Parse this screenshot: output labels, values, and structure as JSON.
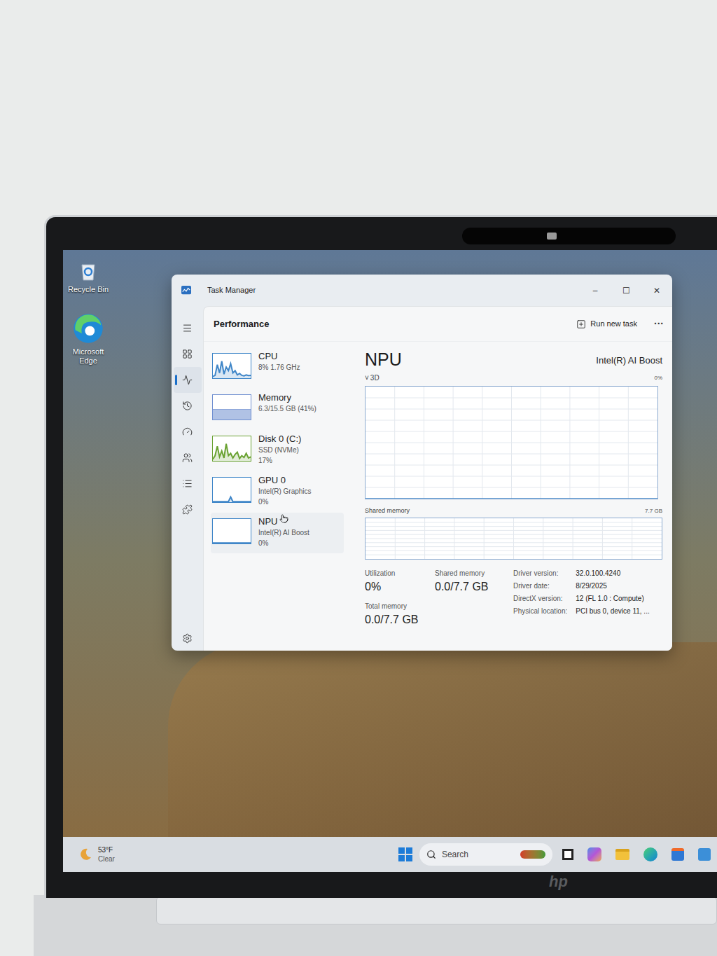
{
  "desktop_icons": [
    {
      "label": "Recycle Bin"
    },
    {
      "label": "Microsoft Edge"
    }
  ],
  "window": {
    "title": "Task Manager",
    "controls": [
      "–",
      "☐",
      "✕"
    ]
  },
  "nav": [
    {
      "selected": false
    },
    {
      "selected": false
    },
    {
      "selected": true
    },
    {
      "selected": false
    },
    {
      "selected": false
    },
    {
      "selected": false
    },
    {
      "selected": false
    },
    {
      "selected": false
    }
  ],
  "header": {
    "title": "Performance",
    "action": "Run new task",
    "more": "···"
  },
  "devices": [
    {
      "name": "CPU",
      "lines": [
        "8% 1.76 GHz"
      ],
      "kind": "line",
      "color": "#3f86c8",
      "selected": false,
      "values": [
        5,
        10,
        55,
        20,
        70,
        15,
        45,
        30,
        60,
        20,
        30,
        12,
        18,
        10,
        8,
        12,
        9,
        10
      ]
    },
    {
      "name": "Memory",
      "lines": [
        "6.3/15.5 GB (41%)"
      ],
      "kind": "fill",
      "color": "#6f8fd0",
      "selected": false,
      "level": 0.41
    },
    {
      "name": "Disk 0 (C:)",
      "lines": [
        "SSD (NVMe)",
        "17%"
      ],
      "kind": "line",
      "color": "#6aa232",
      "selected": false,
      "values": [
        5,
        20,
        60,
        15,
        40,
        10,
        70,
        20,
        30,
        10,
        25,
        35,
        8,
        20,
        12,
        30,
        10,
        15
      ]
    },
    {
      "name": "GPU 0",
      "lines": [
        "Intel(R) Graphics",
        "0%"
      ],
      "kind": "line",
      "color": "#3f86c8",
      "selected": false,
      "values": [
        0,
        0,
        0,
        0,
        0,
        0,
        0,
        0,
        20,
        0,
        0,
        0,
        0,
        0,
        0,
        0,
        0,
        0
      ]
    },
    {
      "name": "NPU",
      "lines": [
        "Intel(R) AI Boost",
        "0%"
      ],
      "kind": "line",
      "color": "#3f86c8",
      "selected": true,
      "values": [
        0,
        0,
        0,
        0,
        0,
        0,
        0,
        0,
        0,
        0,
        0,
        0,
        0,
        0,
        0,
        0,
        0,
        0
      ]
    }
  ],
  "detail": {
    "name": "NPU",
    "model": "Intel(R) AI Boost",
    "chevron": "˅",
    "graph_label": "3D",
    "graph_max": "0%",
    "values": [
      0,
      0,
      0,
      0,
      0,
      0,
      0,
      0,
      0,
      0
    ],
    "shared_label": "Shared memory",
    "shared_max": "7.7 GB",
    "shared_level": 0,
    "stats": [
      {
        "label": "Utilization",
        "value": "0%"
      },
      {
        "label": "Shared memory",
        "value": "0.0/7.7 GB"
      },
      {
        "label": "Total memory",
        "value": "0.0/7.7 GB"
      }
    ],
    "properties": [
      {
        "label": "Driver version:",
        "value": "32.0.100.4240"
      },
      {
        "label": "Driver date:",
        "value": "8/29/2025"
      },
      {
        "label": "DirectX version:",
        "value": "12 (FL 1.0 : Compute)"
      },
      {
        "label": "Physical location:",
        "value": "PCI bus 0, device 11, ..."
      }
    ]
  },
  "taskbar": {
    "temp": "53°F",
    "condition": "Clear",
    "search": "Search"
  },
  "brand": "hp"
}
